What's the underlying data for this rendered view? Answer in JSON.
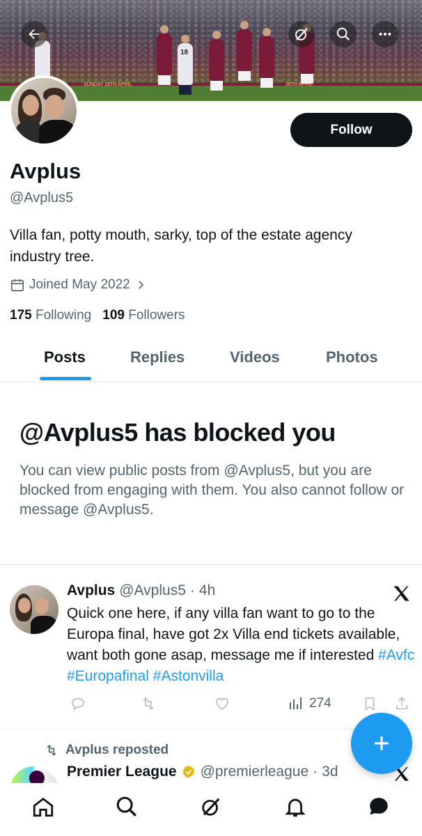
{
  "profile": {
    "name": "Avplus",
    "handle": "@Avplus5",
    "bio": "Villa fan, potty mouth, sarky, top of the estate agency industry tree.",
    "joined": "Joined May 2022",
    "following_count": "175",
    "following_label": "Following",
    "followers_count": "109",
    "followers_label": "Followers",
    "follow_button": "Follow"
  },
  "banner": {
    "board_text_left": "SUNDAY 26TH APRIL",
    "board_text_right": "26TH APRIL",
    "shirt_number": "18"
  },
  "tabs": [
    {
      "label": "Posts",
      "active": true
    },
    {
      "label": "Replies",
      "active": false
    },
    {
      "label": "Videos",
      "active": false
    },
    {
      "label": "Photos",
      "active": false
    }
  ],
  "blocked": {
    "title": "@Avplus5 has blocked you",
    "text": "You can view public posts from @Avplus5, but you are blocked from engaging with them. You also cannot follow or message @Avplus5."
  },
  "post": {
    "name": "Avplus",
    "handle": "@Avplus5",
    "separator": "·",
    "time": "4h",
    "text": "Quick one here, if any villa fan want to go to the Europa final, have got 2x Villa end tickets available, want both gone asap, message me if interested ",
    "hashtags": [
      "#Avfc",
      "#Europafinal",
      "#Astonvilla"
    ],
    "views": "274"
  },
  "repost": {
    "label": "Avplus reposted",
    "name": "Premier League",
    "handle": "@premierleague",
    "separator": "·",
    "time": "3d"
  },
  "icons": {
    "back": "arrow-left-icon",
    "grok": "grok-icon",
    "search": "search-icon",
    "more": "more-icon",
    "calendar": "calendar-icon",
    "chevron": "chevron-right-icon",
    "x_logo": "x-logo-icon",
    "reply": "reply-icon",
    "retweet": "retweet-icon",
    "like": "heart-icon",
    "views": "views-icon",
    "bookmark": "bookmark-icon",
    "share": "share-icon",
    "compose": "plus-icon",
    "home": "home-icon",
    "messages": "messages-icon",
    "notifications": "bell-icon"
  },
  "colors": {
    "accent": "#1d9bf0",
    "text": "#0f1419",
    "muted": "#536471"
  }
}
